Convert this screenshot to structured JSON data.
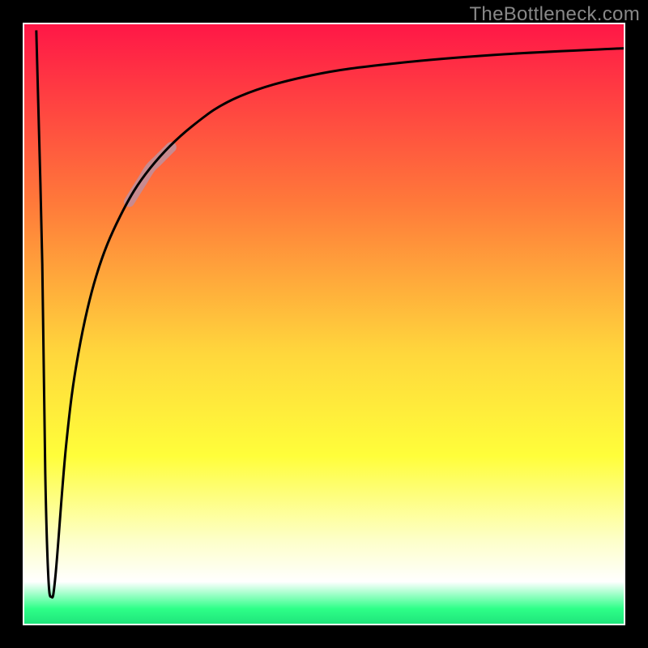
{
  "watermark": "TheBottleneck.com",
  "chart_data": {
    "type": "line",
    "title": "",
    "xlabel": "",
    "ylabel": "",
    "xlim": [
      0,
      100
    ],
    "ylim": [
      0,
      100
    ],
    "grid": false,
    "legend": false,
    "background_gradient": {
      "stops": [
        {
          "pos": 0.0,
          "color": "#ff1747"
        },
        {
          "pos": 0.3,
          "color": "#ff7a3a"
        },
        {
          "pos": 0.55,
          "color": "#ffd73c"
        },
        {
          "pos": 0.72,
          "color": "#fffe3a"
        },
        {
          "pos": 0.86,
          "color": "#fdffc8"
        },
        {
          "pos": 0.93,
          "color": "#ffffff"
        },
        {
          "pos": 0.975,
          "color": "#2eff88"
        },
        {
          "pos": 1.0,
          "color": "#1fe57b"
        }
      ]
    },
    "frame": {
      "color": "#000000",
      "width": 22
    },
    "series": [
      {
        "name": "bottleneck-curve",
        "color": "#000000",
        "stroke_width": 3,
        "points": [
          {
            "x": 2.0,
            "y": 99.0
          },
          {
            "x": 3.0,
            "y": 60.0
          },
          {
            "x": 3.5,
            "y": 25.0
          },
          {
            "x": 4.0,
            "y": 8.0
          },
          {
            "x": 4.5,
            "y": 4.5
          },
          {
            "x": 5.2,
            "y": 8.0
          },
          {
            "x": 7.0,
            "y": 30.0
          },
          {
            "x": 9.0,
            "y": 45.0
          },
          {
            "x": 12.0,
            "y": 58.0
          },
          {
            "x": 16.0,
            "y": 68.0
          },
          {
            "x": 21.0,
            "y": 76.0
          },
          {
            "x": 28.0,
            "y": 83.0
          },
          {
            "x": 36.0,
            "y": 88.0
          },
          {
            "x": 48.0,
            "y": 91.5
          },
          {
            "x": 62.0,
            "y": 93.5
          },
          {
            "x": 80.0,
            "y": 95.0
          },
          {
            "x": 100.0,
            "y": 96.0
          }
        ]
      }
    ],
    "highlight_segment": {
      "series": "bottleneck-curve",
      "x_range": [
        17.5,
        24.5
      ],
      "color": "#c88a8f",
      "stroke_width": 13
    }
  }
}
